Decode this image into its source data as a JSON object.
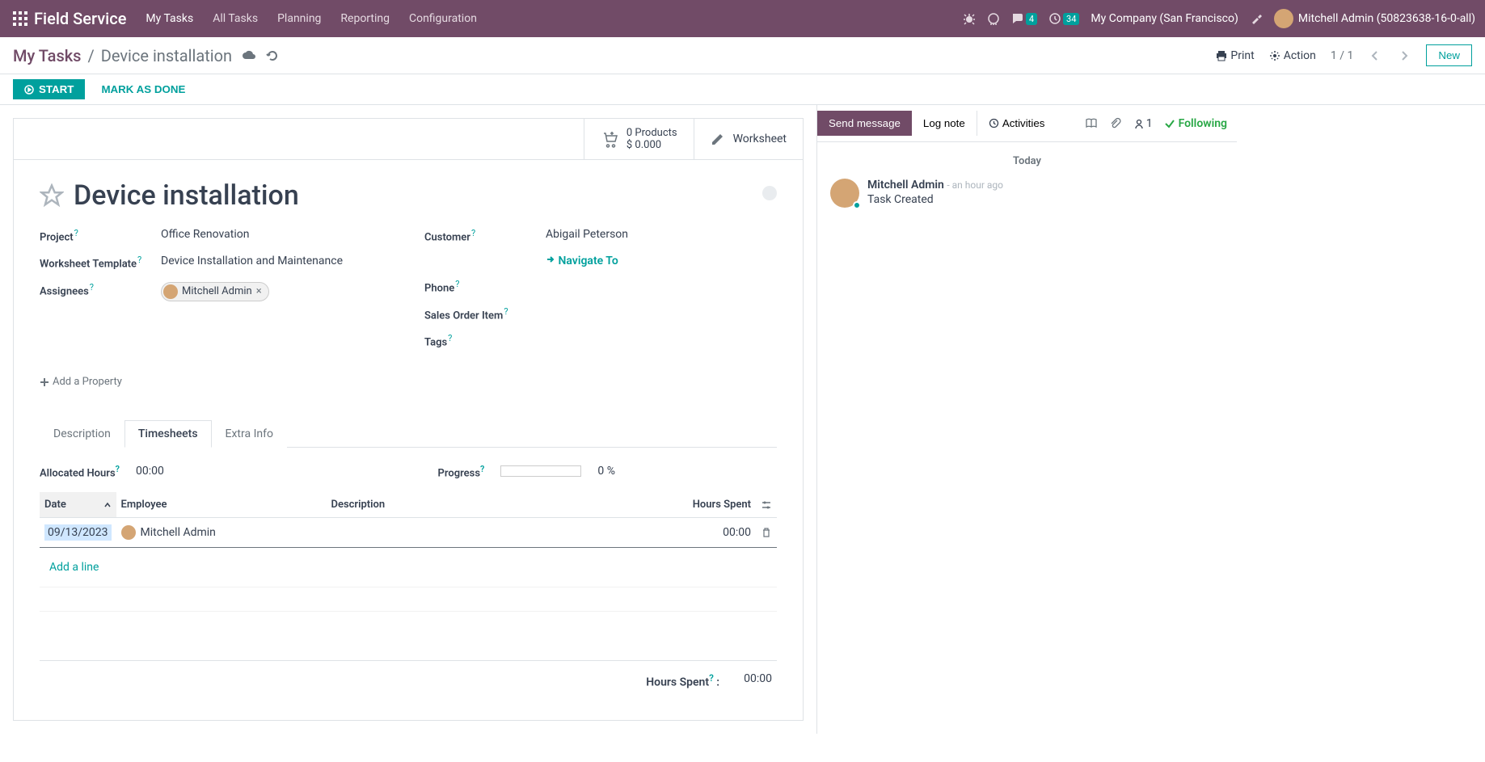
{
  "topbar": {
    "brand": "Field Service",
    "menu": [
      "My Tasks",
      "All Tasks",
      "Planning",
      "Reporting",
      "Configuration"
    ],
    "chat_badge": "4",
    "clock_badge": "34",
    "company": "My Company (San Francisco)",
    "user": "Mitchell Admin (50823638-16-0-all)"
  },
  "control_panel": {
    "breadcrumb_root": "My Tasks",
    "breadcrumb_current": "Device installation",
    "print": "Print",
    "action": "Action",
    "pager": "1 / 1",
    "new": "New"
  },
  "statusbar": {
    "start": "START",
    "done": "MARK AS DONE"
  },
  "stat_buttons": {
    "products_line1": "0 Products",
    "products_line2": "$ 0.000",
    "worksheet": "Worksheet"
  },
  "form": {
    "title": "Device installation",
    "labels": {
      "project": "Project",
      "worksheet_template": "Worksheet Template",
      "assignees": "Assignees",
      "customer": "Customer",
      "phone": "Phone",
      "sales_order_item": "Sales Order Item",
      "tags": "Tags"
    },
    "values": {
      "project": "Office Renovation",
      "worksheet_template": "Device Installation and Maintenance",
      "assignee": "Mitchell Admin",
      "customer": "Abigail Peterson",
      "navigate": "Navigate To"
    },
    "add_property": "Add a Property"
  },
  "tabs": {
    "description": "Description",
    "timesheets": "Timesheets",
    "extra": "Extra Info"
  },
  "timesheets": {
    "allocated_label": "Allocated Hours",
    "allocated_value": "00:00",
    "progress_label": "Progress",
    "progress_value": "0 %",
    "columns": {
      "date": "Date",
      "employee": "Employee",
      "description": "Description",
      "hours_spent": "Hours Spent"
    },
    "row": {
      "date": "09/13/2023",
      "employee": "Mitchell Admin",
      "hours": "00:00"
    },
    "add_line": "Add a line",
    "footer_label": "Hours Spent",
    "footer_value": "00:00"
  },
  "chatter": {
    "send": "Send message",
    "lognote": "Log note",
    "activities": "Activities",
    "follower_count": "1",
    "following": "Following",
    "day": "Today",
    "author": "Mitchell Admin",
    "time": "- an hour ago",
    "body": "Task Created"
  }
}
